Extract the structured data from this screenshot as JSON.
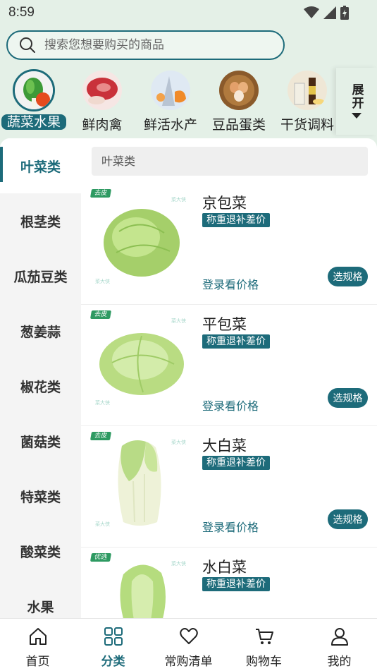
{
  "status": {
    "time": "8:59"
  },
  "search": {
    "placeholder": "搜索您想要购买的商品"
  },
  "categories": [
    {
      "label": "蔬菜水果",
      "active": true
    },
    {
      "label": "鲜肉禽",
      "active": false
    },
    {
      "label": "鲜活水产",
      "active": false
    },
    {
      "label": "豆品蛋类",
      "active": false
    },
    {
      "label": "干货调料",
      "active": false
    }
  ],
  "expand": {
    "label": "展开"
  },
  "sidebar": {
    "items": [
      {
        "label": "叶菜类",
        "active": true
      },
      {
        "label": "根茎类"
      },
      {
        "label": "瓜茄豆类"
      },
      {
        "label": "葱姜蒜"
      },
      {
        "label": "椒花类"
      },
      {
        "label": "菌菇类"
      },
      {
        "label": "特菜类"
      },
      {
        "label": "酸菜类"
      },
      {
        "label": "水果"
      }
    ]
  },
  "subcategory": {
    "title": "叶菜类"
  },
  "products": [
    {
      "name": "京包菜",
      "tag": "去皮",
      "badge": "称重退补差价",
      "price": "登录看价格",
      "button": "选规格",
      "watermark": "菜大侠"
    },
    {
      "name": "平包菜",
      "tag": "去皮",
      "badge": "称重退补差价",
      "price": "登录看价格",
      "button": "选规格",
      "watermark": "菜大侠"
    },
    {
      "name": "大白菜",
      "tag": "去皮",
      "badge": "称重退补差价",
      "price": "登录看价格",
      "button": "选规格",
      "watermark": "菜大侠"
    },
    {
      "name": "水白菜",
      "tag": "优选",
      "badge": "称重退补差价",
      "price": "",
      "button": "",
      "watermark": "菜大侠"
    }
  ],
  "bottom_nav": {
    "tabs": [
      {
        "label": "首页",
        "icon": "home-icon"
      },
      {
        "label": "分类",
        "icon": "grid-icon",
        "active": true
      },
      {
        "label": "常购清单",
        "icon": "heart-icon"
      },
      {
        "label": "购物车",
        "icon": "cart-icon"
      },
      {
        "label": "我的",
        "icon": "user-icon"
      }
    ]
  },
  "colors": {
    "accent": "#1d6b7a",
    "tag_green": "#2e9a62",
    "background": "#e4f0e7"
  }
}
